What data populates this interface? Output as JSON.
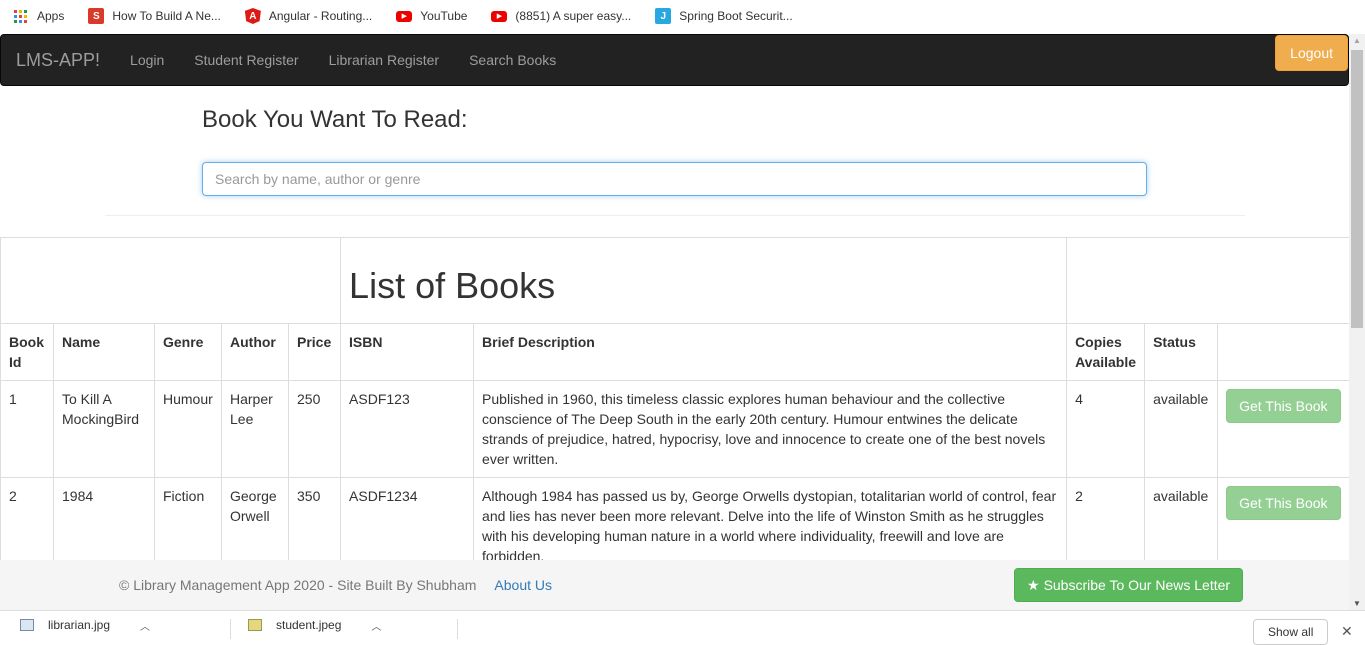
{
  "bookmarks": [
    {
      "label": "Apps",
      "icon": "apps-grid-icon"
    },
    {
      "label": "How To Build A Ne...",
      "icon": "s-logo-icon",
      "color": "#d93b2b"
    },
    {
      "label": "Angular - Routing...",
      "icon": "angular-icon",
      "color": "#dd1b16"
    },
    {
      "label": "YouTube",
      "icon": "youtube-icon",
      "color": "#e00"
    },
    {
      "label": "(8851) A super easy...",
      "icon": "youtube-icon",
      "color": "#e00"
    },
    {
      "label": "Spring Boot Securit...",
      "icon": "j-logo-icon",
      "color": "#29a8e0"
    }
  ],
  "navbar": {
    "brand": "LMS-APP!",
    "links": [
      "Login",
      "Student Register",
      "Librarian Register",
      "Search Books"
    ],
    "logout": "Logout"
  },
  "search": {
    "heading": "Book You Want To Read:",
    "placeholder": "Search by name, author or genre"
  },
  "table": {
    "caption": "List of Books",
    "headers": [
      "Book Id",
      "Name",
      "Genre",
      "Author",
      "Price",
      "ISBN",
      "Brief Description",
      "Copies Available",
      "Status"
    ],
    "rows": [
      {
        "id": "1",
        "name": "To Kill A MockingBird",
        "genre": "Humour",
        "author": "Harper Lee",
        "price": "250",
        "isbn": "ASDF123",
        "description": "Published in 1960, this timeless classic explores human behaviour and the collective conscience of The Deep South in the early 20th century. Humour entwines the delicate strands of prejudice, hatred, hypocrisy, love and innocence to create one of the best novels ever written.",
        "copies": "4",
        "status": "available",
        "action": "Get This Book"
      },
      {
        "id": "2",
        "name": "1984",
        "genre": "Fiction",
        "author": "George Orwell",
        "price": "350",
        "isbn": "ASDF1234",
        "description": "Although 1984 has passed us by, George Orwells dystopian, totalitarian world of control, fear and lies has never been more relevant. Delve into the life of Winston Smith as he struggles with his developing human nature in a world where individuality, freewill and love are forbidden.",
        "copies": "2",
        "status": "available",
        "action": "Get This Book"
      }
    ]
  },
  "footer": {
    "text": "© Library Management App 2020 - Site Built By Shubham",
    "about": "About Us",
    "subscribe": "Subscribe To Our News Letter"
  },
  "downloads": {
    "items": [
      "librarian.jpg",
      "student.jpeg"
    ],
    "show_all": "Show all"
  },
  "colors": {
    "navbar_bg": "#222222",
    "logout": "#f0ad4e",
    "success": "#5cb85c",
    "link": "#337ab7"
  }
}
